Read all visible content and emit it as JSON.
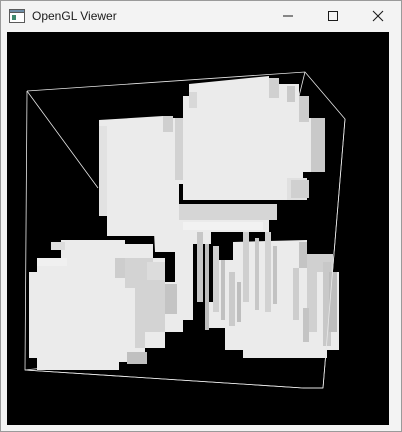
{
  "window": {
    "title": "OpenGL Viewer"
  },
  "controls": {
    "minimize_icon": "minimize-icon",
    "maximize_icon": "maximize-icon",
    "close_icon": "close-icon"
  },
  "viewport": {
    "background": "#000000",
    "wireframe_color": "#e8e8e8",
    "voxel_light": "#ebebeb",
    "voxel_mid": "#d4d4d4",
    "voxel_dark": "#b9b9b9"
  }
}
